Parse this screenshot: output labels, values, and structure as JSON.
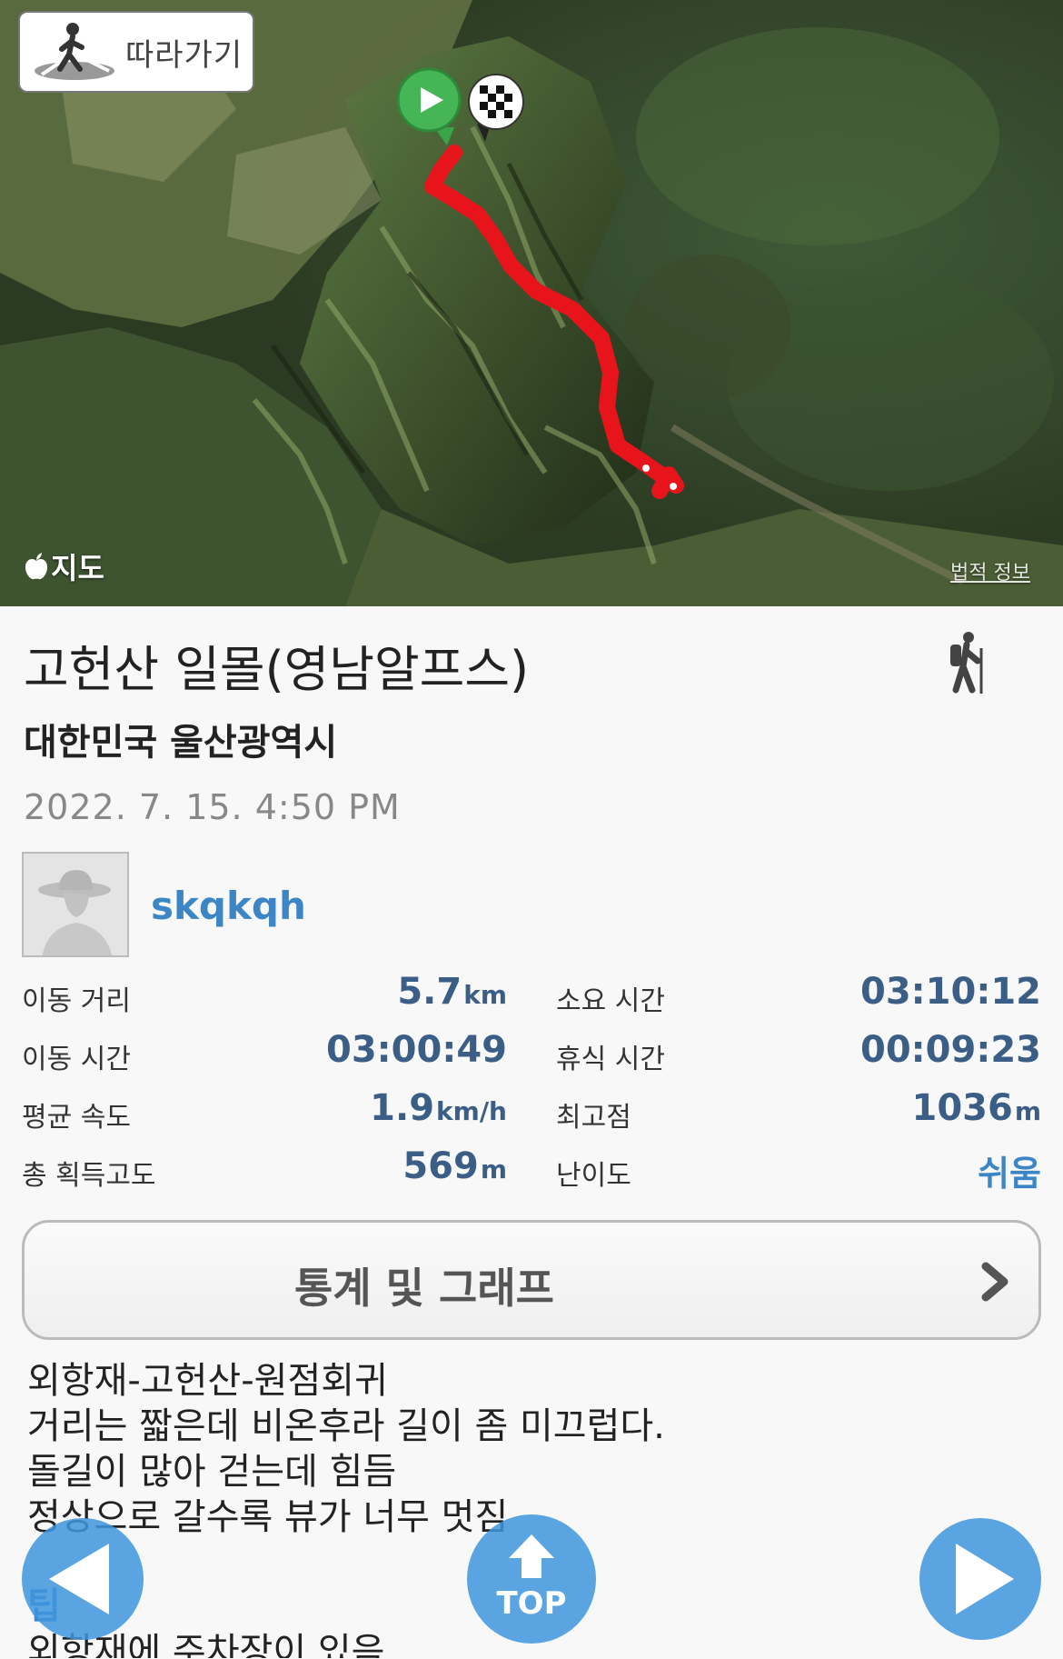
{
  "map": {
    "follow_label": "따라가기",
    "provider_label": "지도",
    "legal_label": "법적 정보"
  },
  "track": {
    "title": "고헌산 일몰(영남알프스)",
    "region": "대한민국 울산광역시",
    "date": "2022. 7. 15. 4:50 PM",
    "activity_icon": "hiker-icon",
    "user": {
      "name": "skqkqh"
    }
  },
  "stats": [
    {
      "label": "이동 거리",
      "value": "5.7",
      "unit": "km"
    },
    {
      "label": "소요 시간",
      "value": "03:10:12",
      "unit": ""
    },
    {
      "label": "이동 시간",
      "value": "03:00:49",
      "unit": ""
    },
    {
      "label": "휴식 시간",
      "value": "00:09:23",
      "unit": ""
    },
    {
      "label": "평균 속도",
      "value": "1.9",
      "unit": "km/h"
    },
    {
      "label": "최고점",
      "value": "1036",
      "unit": "m"
    },
    {
      "label": "총 획득고도",
      "value": "569",
      "unit": "m"
    },
    {
      "label": "난이도",
      "value": "쉬움",
      "unit": ""
    }
  ],
  "graph_button": {
    "label": "통계 및 그래프"
  },
  "description": {
    "lines": [
      "외항재-고헌산-원점회귀",
      "거리는 짧은데 비온후라 길이 좀 미끄럽다.",
      "돌길이 많아 걷는데 힘듬",
      "정상으로 갈수록 뷰가 너무 멋짐"
    ],
    "tip_label": "팁",
    "tip_lines": [
      "외항재에 주차장이 있음"
    ]
  },
  "nav": {
    "top_label": "TOP"
  },
  "colors": {
    "accent": "#3d86c6",
    "route": "#e8141c",
    "fab": "#4095de"
  }
}
